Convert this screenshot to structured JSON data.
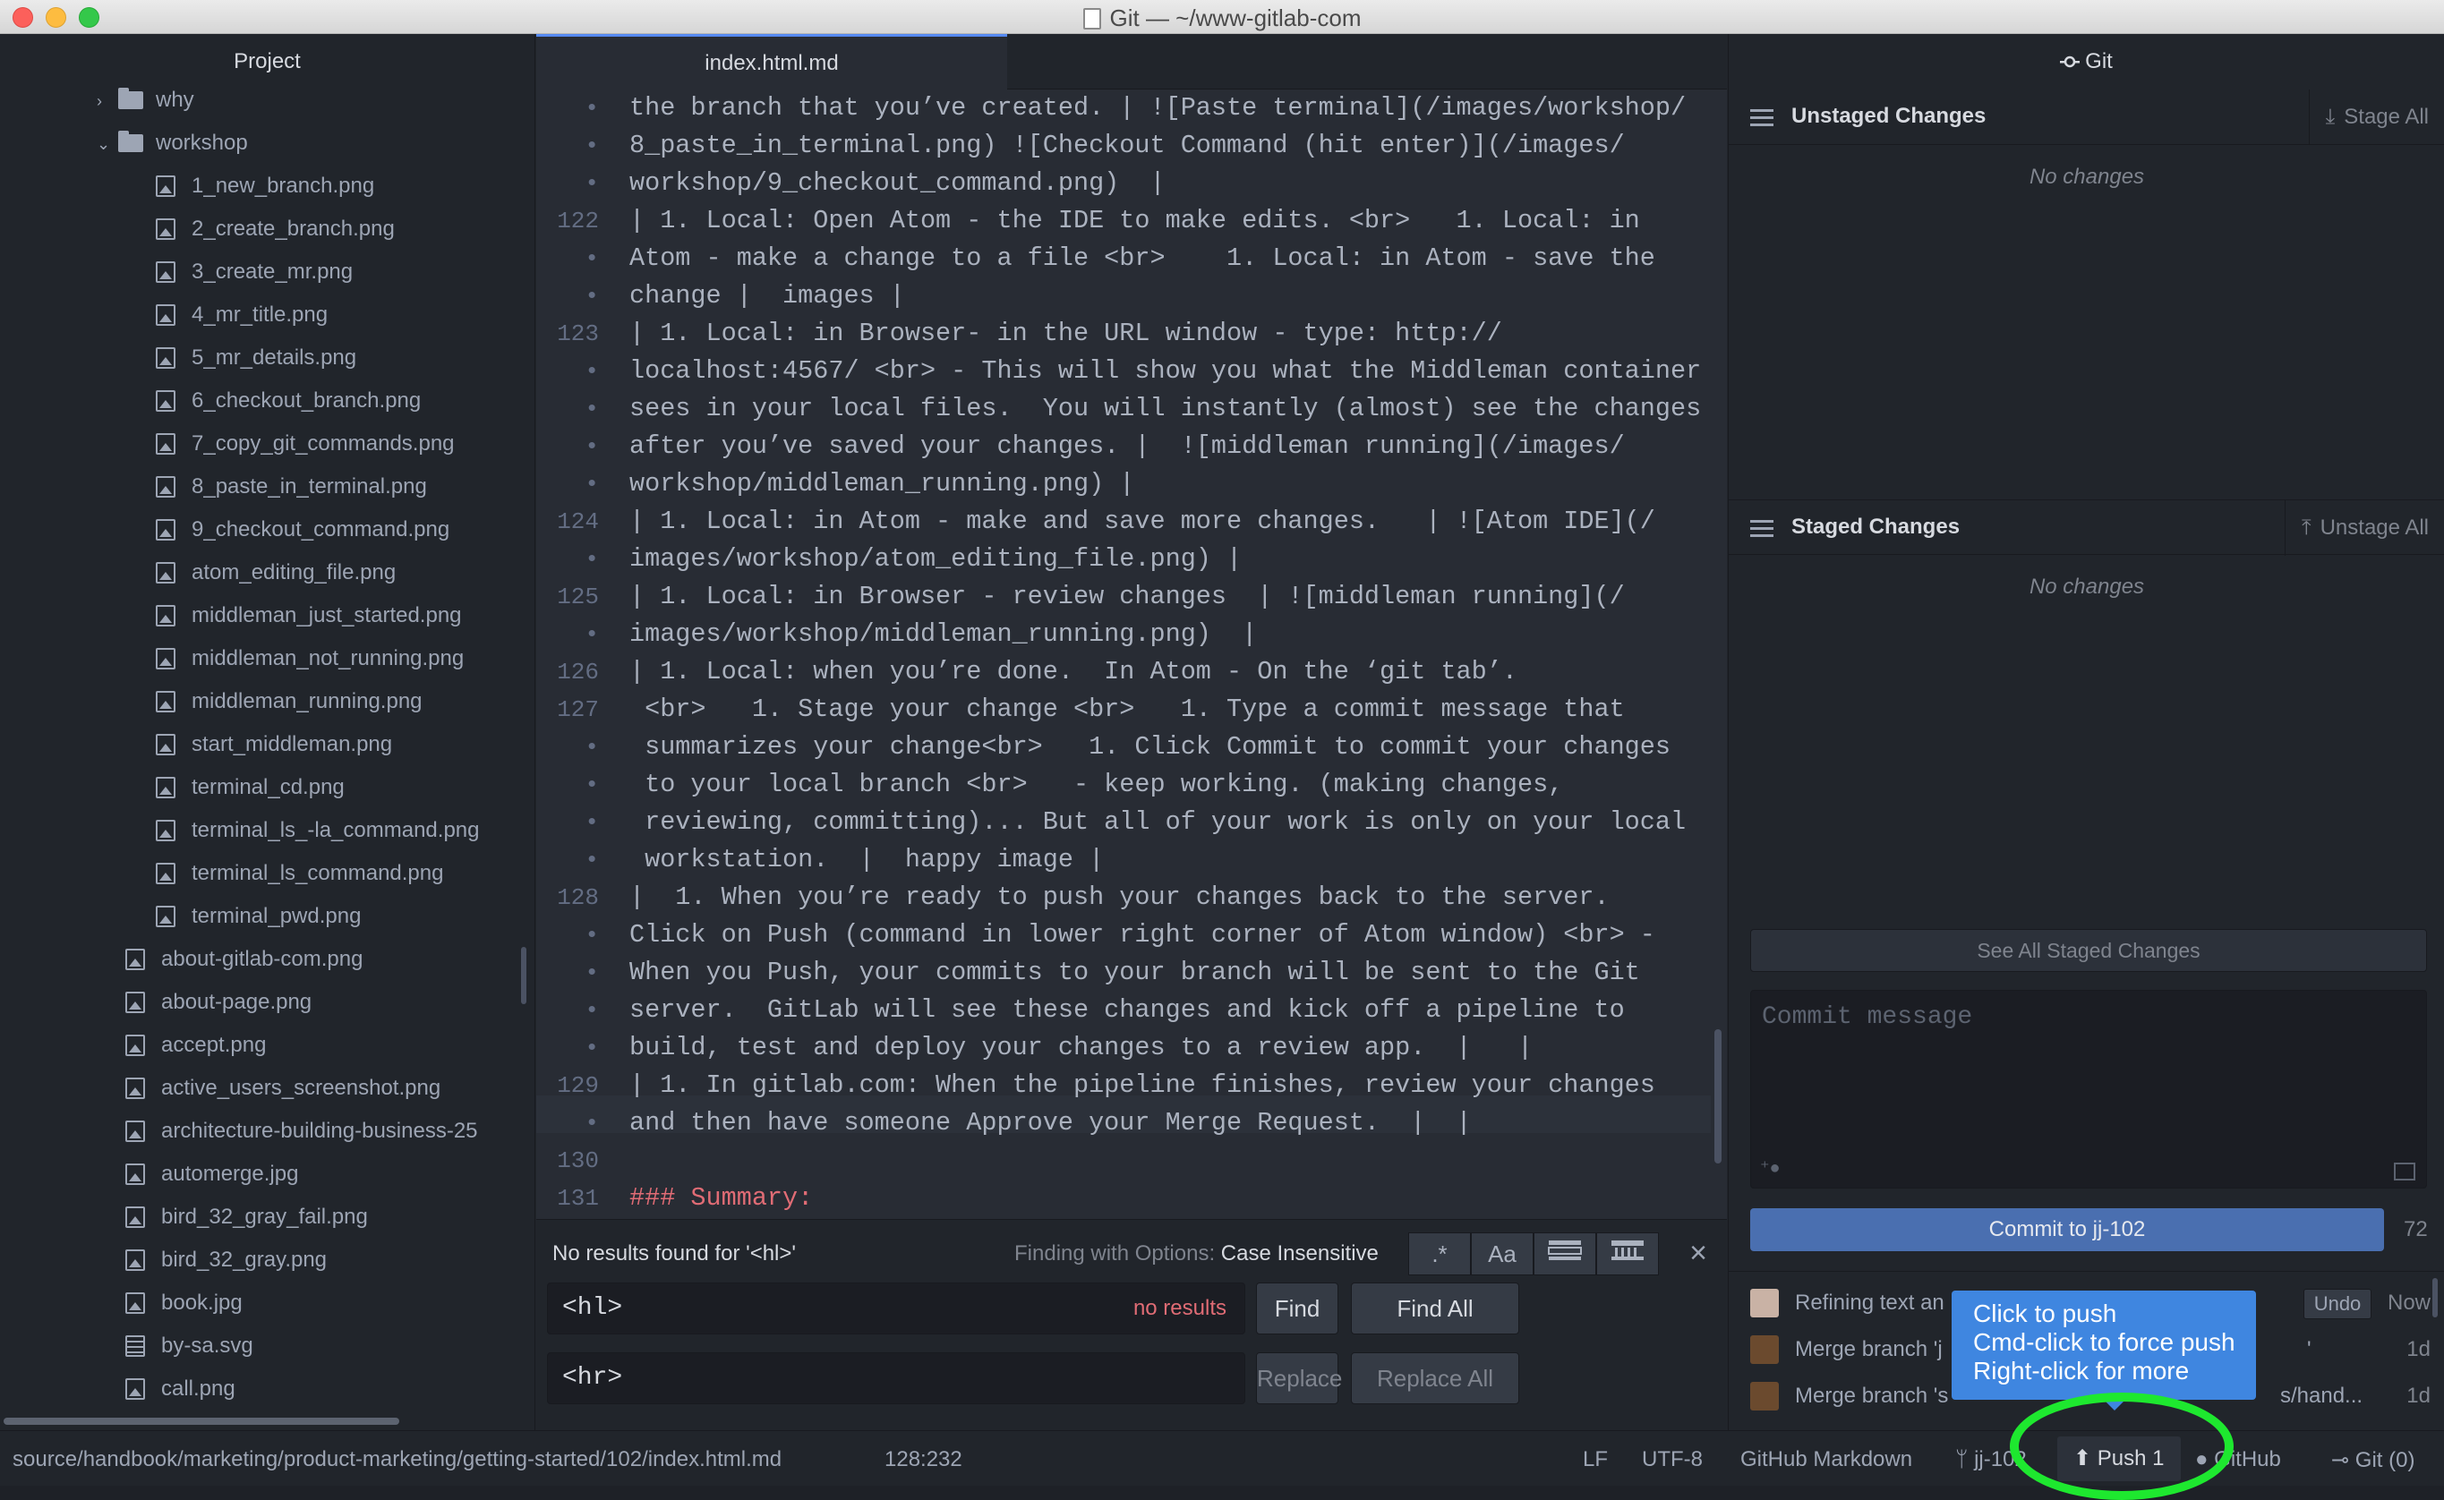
{
  "window": {
    "title": "Git — ~/www-gitlab-com"
  },
  "tree": {
    "header": "Project",
    "items": [
      {
        "label": "why",
        "type": "folder",
        "expanded": false
      },
      {
        "label": "workshop",
        "type": "folder",
        "expanded": true
      },
      {
        "label": "1_new_branch.png",
        "type": "image"
      },
      {
        "label": "2_create_branch.png",
        "type": "image"
      },
      {
        "label": "3_create_mr.png",
        "type": "image"
      },
      {
        "label": "4_mr_title.png",
        "type": "image"
      },
      {
        "label": "5_mr_details.png",
        "type": "image"
      },
      {
        "label": "6_checkout_branch.png",
        "type": "image"
      },
      {
        "label": "7_copy_git_commands.png",
        "type": "image"
      },
      {
        "label": "8_paste_in_terminal.png",
        "type": "image"
      },
      {
        "label": "9_checkout_command.png",
        "type": "image"
      },
      {
        "label": "atom_editing_file.png",
        "type": "image"
      },
      {
        "label": "middleman_just_started.png",
        "type": "image"
      },
      {
        "label": "middleman_not_running.png",
        "type": "image"
      },
      {
        "label": "middleman_running.png",
        "type": "image"
      },
      {
        "label": "start_middleman.png",
        "type": "image"
      },
      {
        "label": "terminal_cd.png",
        "type": "image"
      },
      {
        "label": "terminal_ls_-la_command.png",
        "type": "image"
      },
      {
        "label": "terminal_ls_command.png",
        "type": "image"
      },
      {
        "label": "terminal_pwd.png",
        "type": "image"
      },
      {
        "label": "about-gitlab-com.png",
        "type": "image"
      },
      {
        "label": "about-page.png",
        "type": "image"
      },
      {
        "label": "accept.png",
        "type": "image"
      },
      {
        "label": "active_users_screenshot.png",
        "type": "image"
      },
      {
        "label": "architecture-building-business-25",
        "type": "image"
      },
      {
        "label": "automerge.jpg",
        "type": "image"
      },
      {
        "label": "bird_32_gray_fail.png",
        "type": "image"
      },
      {
        "label": "bird_32_gray.png",
        "type": "image"
      },
      {
        "label": "book.jpg",
        "type": "image"
      },
      {
        "label": "by-sa.svg",
        "type": "text"
      },
      {
        "label": "call.png",
        "type": "image"
      }
    ]
  },
  "editor": {
    "tab": "index.html.md",
    "lines": [
      {
        "num": "•",
        "text": "the branch that you’ve created. | ![Paste terminal](/images/workshop/"
      },
      {
        "num": "•",
        "text": "8_paste_in_terminal.png) ![Checkout Command (hit enter)](/images/"
      },
      {
        "num": "•",
        "text": "workshop/9_checkout_command.png)  |"
      },
      {
        "num": "122",
        "text": "| 1. Local: Open Atom - the IDE to make edits. <br>   1. Local: in"
      },
      {
        "num": "•",
        "text": "Atom - make a change to a file <br>    1. Local: in Atom - save the"
      },
      {
        "num": "•",
        "text": "change |  images |"
      },
      {
        "num": "123",
        "text": "| 1. Local: in Browser- in the URL window - type: http://"
      },
      {
        "num": "•",
        "text": "localhost:4567/ <br> - This will show you what the Middleman container"
      },
      {
        "num": "•",
        "text": "sees in your local files.  You will instantly (almost) see the changes"
      },
      {
        "num": "•",
        "text": "after you’ve saved your changes. |  ![middleman running](/images/"
      },
      {
        "num": "•",
        "text": "workshop/middleman_running.png) |"
      },
      {
        "num": "124",
        "text": "| 1. Local: in Atom - make and save more changes.   | ![Atom IDE](/"
      },
      {
        "num": "•",
        "text": "images/workshop/atom_editing_file.png) |"
      },
      {
        "num": "125",
        "text": "| 1. Local: in Browser - review changes  | ![middleman running](/"
      },
      {
        "num": "•",
        "text": "images/workshop/middleman_running.png)  |"
      },
      {
        "num": "126",
        "text": "| 1. Local: when you’re done.  In Atom - On the ‘git tab’."
      },
      {
        "num": "127",
        "text": " <br>   1. Stage your change <br>   1. Type a commit message that"
      },
      {
        "num": "•",
        "text": " summarizes your change<br>   1. Click Commit to commit your changes"
      },
      {
        "num": "•",
        "text": " to your local branch <br>   - keep working. (making changes,"
      },
      {
        "num": "•",
        "text": " reviewing, committing)... But all of your work is only on your local"
      },
      {
        "num": "•",
        "text": " workstation.  |  happy image |"
      },
      {
        "num": "128",
        "text": "|  1. When you’re ready to push your changes back to the server."
      },
      {
        "num": "•",
        "text": "Click on Push (command in lower right corner of Atom window) <br> -"
      },
      {
        "num": "•",
        "text": "When you Push, your commits to your branch will be sent to the Git"
      },
      {
        "num": "•",
        "text": "server.  GitLab will see these changes and kick off a pipeline to"
      },
      {
        "num": "•",
        "text": "build, test and deploy your changes to a review app.  |   |"
      },
      {
        "num": "129",
        "text": "| 1. In gitlab.com: When the pipeline finishes, review your changes"
      },
      {
        "num": "•",
        "text": "and then have someone Approve your Merge Request.  |  |"
      },
      {
        "num": "130",
        "text": ""
      },
      {
        "num": "131",
        "text": "### Summary:"
      }
    ]
  },
  "find": {
    "description": "No results found for '<hl>'",
    "options_label": "Finding with Options:",
    "options_value": "Case Insensitive",
    "opt_regex": ".*",
    "opt_case": "Aa",
    "find_value": "<hl>",
    "no_results": "no results",
    "find_label": "Find",
    "find_all_label": "Find All",
    "replace_value": "<hr>",
    "replace_label": "Replace",
    "replace_all_label": "Replace All"
  },
  "git": {
    "header": "Git",
    "unstaged_title": "Unstaged Changes",
    "stage_all": "Stage All",
    "unstaged_empty": "No changes",
    "staged_title": "Staged Changes",
    "unstage_all": "Unstage All",
    "staged_empty": "No changes",
    "see_all": "See All Staged Changes",
    "commit_placeholder": "Commit message",
    "commit_button": "Commit to jj-102",
    "char_count": "72",
    "commits": [
      {
        "message": "Refining text an",
        "time": "Now",
        "undo": "Undo"
      },
      {
        "message": "Merge branch 'j",
        "suffix": "'",
        "time": "1d"
      },
      {
        "message": "Merge branch 's",
        "suffix": "s/hand...",
        "time": "1d"
      }
    ]
  },
  "tooltip": {
    "line1": "Click to push",
    "line2": "Cmd-click to force push",
    "line3": "Right-click for more"
  },
  "status": {
    "path": "source/handbook/marketing/product-marketing/getting-started/102/index.html.md",
    "cursor": "128:232",
    "eol": "LF",
    "encoding": "UTF-8",
    "grammar": "GitHub Markdown",
    "branch": "jj-102",
    "push": "Push 1",
    "github": "GitHub",
    "git": "Git (0)"
  }
}
